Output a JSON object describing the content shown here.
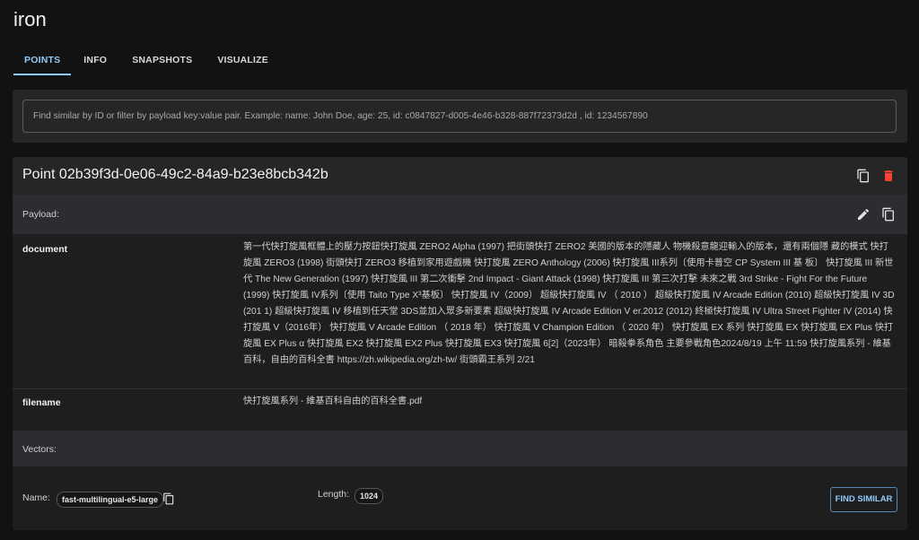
{
  "app": {
    "title": "iron"
  },
  "tabs": [
    {
      "label": "POINTS",
      "active": true
    },
    {
      "label": "INFO",
      "active": false
    },
    {
      "label": "SNAPSHOTS",
      "active": false
    },
    {
      "label": "VISUALIZE",
      "active": false
    }
  ],
  "search": {
    "placeholder": "Find similar by ID or filter by payload key:value pair. Example: name: John Doe, age: 25, id: c0847827-d005-4e46-b328-887f72373d2d , id: 1234567890",
    "value": ""
  },
  "point": {
    "title": "Point 02b39f3d-0e06-49c2-84a9-b23e8bcb342b",
    "header_icons": [
      "copy-icon",
      "delete-icon"
    ],
    "delete_color": "#f44336",
    "payload_label": "Payload:",
    "payload_icons": [
      "edit-icon",
      "copy-icon"
    ],
    "fields": [
      {
        "key": "document",
        "value": "第一代快打旋風框體上的壓力按鈕快打旋風 ZERO2 Alpha (1997) 把街頭快打 ZERO2 美國的版本的隱藏人 物機殺意龍迎輸入的版本，還有兩個隱 藏的模式 快打旋風 ZERO3 (1998) 街頭快打 ZERO3 移植到家用遊戲機 快打旋風 ZERO Anthology (2006) 快打旋風 III系列〔使用卡普空 CP System III 基 板〕 快打旋風 III 新世代 The New Generation (1997) 快打旋風 III 第二次衝擊 2nd Impact - Giant Attack (1998) 快打旋風 III 第三次打擊 未來之戰 3rd Strike - Fight For the Future (1999) 快打旋風 IV系列〔使用 Taito Type X³基板〕 快打旋風 IV（2009） 超級快打旋風 IV （ 2010 ） 超級快打旋風 IV Arcade Edition (2010) 超級快打旋風 IV 3D (201 1) 超級快打旋風 IV 移植到任天堂 3DS並加入眾多新要素 超級快打旋風 IV Arcade Edition V er.2012 (2012) 終極快打旋風 IV Ultra Street Fighter IV (2014) 快打旋風 V（2016年） 快打旋風 V Arcade Edition （ 2018 年） 快打旋風 V Champion Edition （ 2020 年） 快打旋風 EX 系列 快打旋風 EX 快打旋風 EX Plus 快打旋風 EX Plus α 快打旋風 EX2 快打旋風 EX2 Plus 快打旋風 EX3 快打旋風 6[2]（2023年） 暗殺拳系角色 主要參戰角色2024/8/19 上午 11:59 快打旋風系列 - 維基百科，自由的百科全書 https://zh.wikipedia.org/zh-tw/ 街頭霸王系列 2/21"
      },
      {
        "key": "filename",
        "value": "快打旋風系列 - 維基百科自由的百科全書.pdf"
      }
    ],
    "vectors": {
      "label": "Vectors:",
      "name_label": "Name:",
      "name_value": "fast-multilingual-e5-large",
      "length_label": "Length:",
      "length_value": "1024",
      "find_similar_label": "FIND SIMILAR"
    }
  },
  "colors": {
    "accent": "#90caf9",
    "background": "#121212",
    "panel": "#262626",
    "danger": "#f44336"
  }
}
